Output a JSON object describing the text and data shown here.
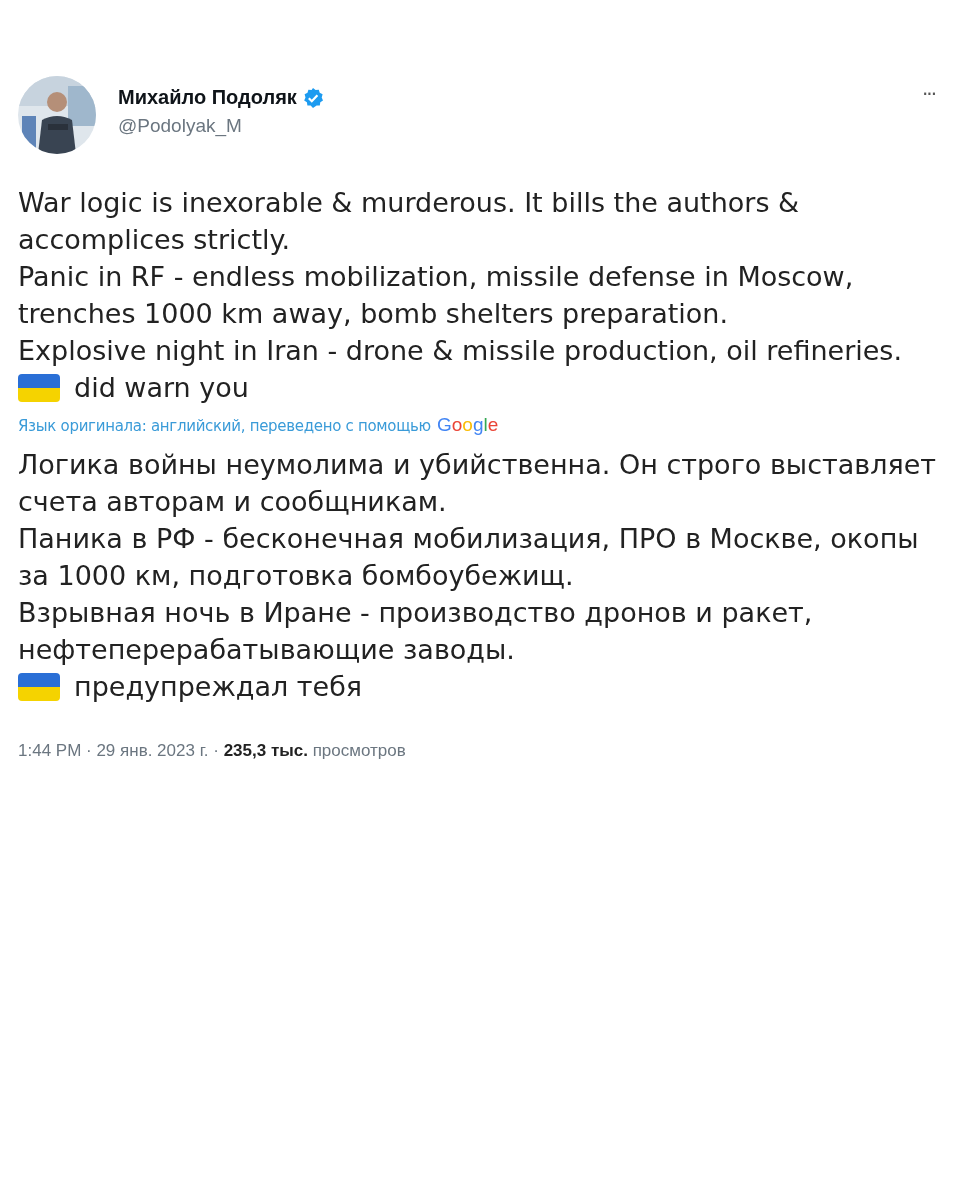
{
  "author": {
    "name": "Михайло Подоляк",
    "verified": true,
    "handle": "@Podolyak_M"
  },
  "menu": "···",
  "original": [
    {
      "kind": "text",
      "text": "War logic is inexorable & murderous. It bills the authors & accomplices strictly."
    },
    {
      "kind": "text",
      "text": "Panic in RF - endless mobilization, missile defense in Moscow, trenches 1000 km away, bomb shelters preparation."
    },
    {
      "kind": "text",
      "text": "Explosive night in Iran - drone & missile production, oil refineries."
    },
    {
      "kind": "flag",
      "text": "did warn you"
    }
  ],
  "translation_note": {
    "text": "Язык оригинала: английский, переведено с помощью",
    "logo": "Google"
  },
  "translated": [
    {
      "kind": "text",
      "text": "Логика войны неумолима и убийственна. Он строго выставляет счета авторам и сообщникам."
    },
    {
      "kind": "text",
      "text": "Паника в РФ - бесконечная мобилизация, ПРО в Москве, окопы за 1000 км, подготовка бомбоубежищ."
    },
    {
      "kind": "text",
      "text": "Взрывная ночь в Иране - производство дронов и ракет, нефтеперерабатывающие заводы."
    },
    {
      "kind": "flag",
      "text": "предупреждал тебя"
    }
  ],
  "footer": "1:44 PM · 29 янв. 2023 г. · **235,3 тыс.** просмотров"
}
